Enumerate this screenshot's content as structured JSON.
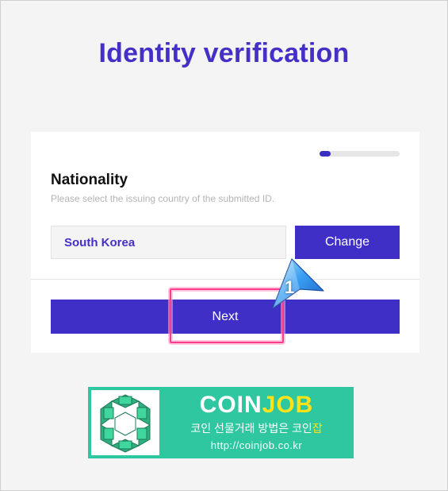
{
  "page": {
    "title": "Identity verification"
  },
  "progress": {
    "fraction": 0.14
  },
  "nationality": {
    "title": "Nationality",
    "description": "Please select the issuing country of the submitted ID.",
    "selected_country": "South Korea",
    "change_label": "Change"
  },
  "next_label": "Next",
  "annotation": {
    "step_number": "1"
  },
  "banner": {
    "brand_part1": "COIN",
    "brand_part2": "JOB",
    "tagline_part1": "코인 선물거래 방법은 코인",
    "tagline_part2": "잡",
    "url": "http://coinjob.co.kr"
  },
  "colors": {
    "accent": "#3f2fc7",
    "title": "#4430c6",
    "banner_bg": "#2ec7a0",
    "banner_highlight": "#ffe21a",
    "annotation_box": "#ff3d8e"
  },
  "icons": {
    "banner_logo": "coinjob-logo-icon",
    "annotation_arrow": "step-pointer-icon"
  }
}
